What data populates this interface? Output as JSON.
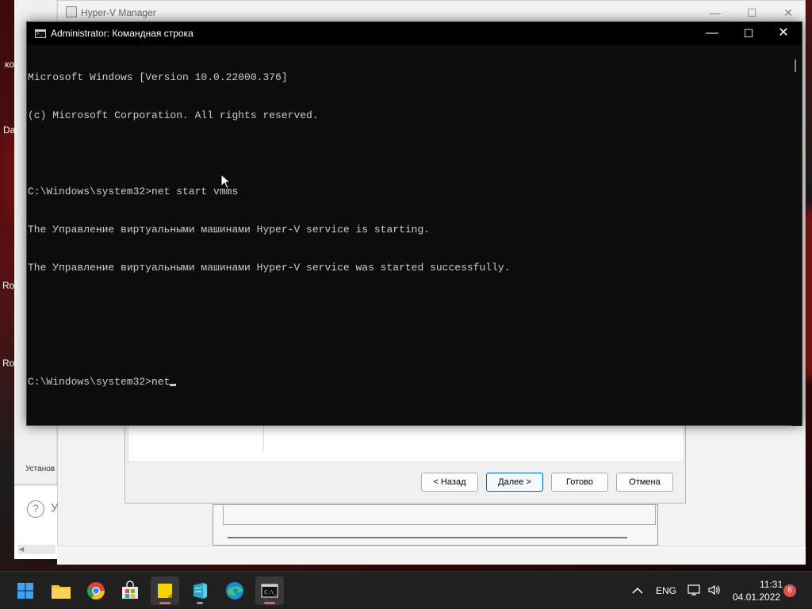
{
  "hyperv": {
    "title": "Hyper-V Manager",
    "minimize": "—",
    "maximize": "☐",
    "close": "✕"
  },
  "desktop": {
    "label_1": "ко",
    "label_2": "Da",
    "label_3": "Ro",
    "label_4": "Ro",
    "left_pane_status": "Установ",
    "help_prefix": "У"
  },
  "wizard": {
    "back_label": "< Назад",
    "next_label": "Далее >",
    "finish_label": "Готово",
    "cancel_label": "Отмена"
  },
  "cmd": {
    "title": "Administrator: Командная строка",
    "minimize": "—",
    "maximize": "☐",
    "close": "✕",
    "lines": [
      "Microsoft Windows [Version 10.0.22000.376]",
      "(c) Microsoft Corporation. All rights reserved.",
      "",
      "C:\\Windows\\system32>net start vmms",
      "The Управление виртуальными машинами Hyper-V service is starting.",
      "The Управление виртуальными машинами Hyper-V service was started successfully.",
      "",
      ""
    ],
    "prompt": "C:\\Windows\\system32>",
    "current_input": "net"
  },
  "taskbar": {
    "apps": [
      "windows-start",
      "file-explorer",
      "chrome",
      "microsoft-store",
      "sticky-notes",
      "azure-data-studio",
      "microsoft-edge",
      "command-prompt"
    ],
    "tray_chevron": "^",
    "language": "ENG",
    "time": "11:31",
    "date": "04.01.2022",
    "notification_count": "6"
  },
  "colors": {
    "console_bg": "#0c0c0c",
    "console_fg": "#cccccc",
    "taskbar_bg": "#202020",
    "accent": "#0067c0",
    "badge": "#e05050"
  }
}
